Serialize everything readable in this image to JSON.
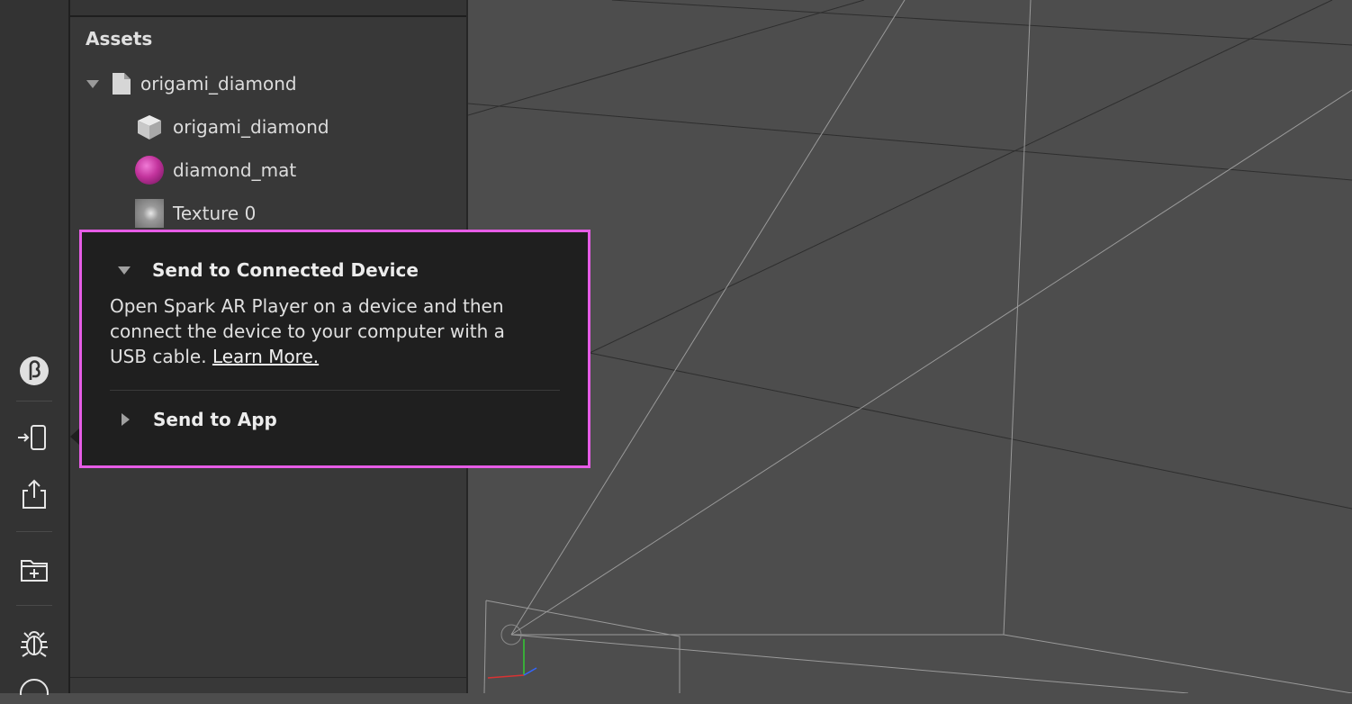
{
  "toolbar": {
    "beta_icon": "beta-icon",
    "test_icon": "send-to-device-icon",
    "share_icon": "share-upload-icon",
    "folder_icon": "add-folder-icon",
    "bug_icon": "bug-icon",
    "help_icon": "help-icon"
  },
  "assets": {
    "title": "Assets",
    "items": [
      {
        "label": "origami_diamond",
        "icon": "file-icon"
      },
      {
        "label": "origami_diamond",
        "icon": "mesh-cube-icon"
      },
      {
        "label": "diamond_mat",
        "icon": "material-sphere-icon"
      },
      {
        "label": "Texture 0",
        "icon": "texture-thumbnail-icon"
      }
    ]
  },
  "popup": {
    "section1": {
      "title": "Send to Connected Device",
      "body": "Open Spark AR Player on a device and then connect the device to your computer with a USB cable.",
      "link": "Learn More."
    },
    "section2": {
      "title": "Send to App"
    }
  },
  "colors": {
    "highlight_border": "#e65ce6",
    "popup_bg": "#1f1f1f",
    "panel_bg": "#383838",
    "toolbar_bg": "#333333",
    "viewport_bg": "#4d4d4d"
  }
}
